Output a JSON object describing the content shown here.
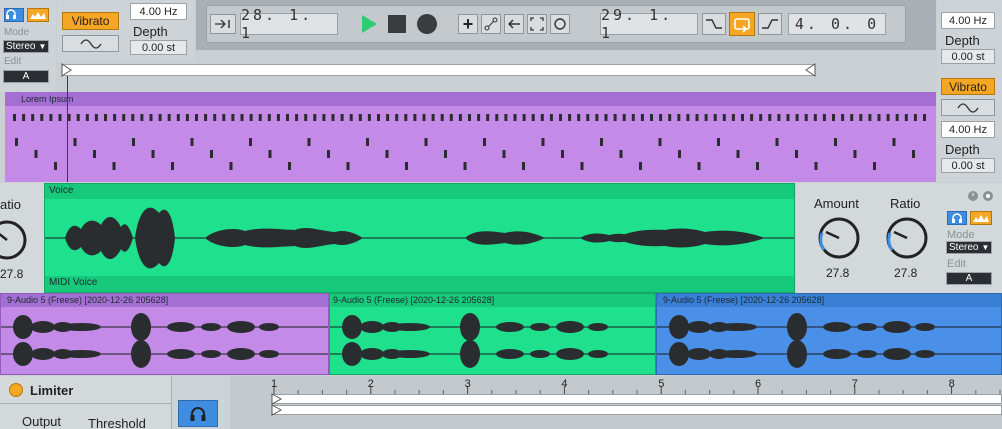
{
  "topleft": {
    "mode_label": "Mode",
    "mode_value": "Stereo",
    "edit_label": "Edit",
    "edit_value": "A"
  },
  "vibrato_left": {
    "button_label": "Vibrato",
    "rate_value": "4.00 Hz",
    "depth_label": "Depth",
    "depth_value": "0.00 st"
  },
  "transport": {
    "position": "28. 1. 1",
    "loop_start": "29. 1. 1",
    "loop_length": "4. 0. 0"
  },
  "right_top": {
    "rate_value": "4.00 Hz",
    "depth_label": "Depth",
    "depth_value": "0.00 st",
    "vibrato_label": "Vibrato",
    "rate_value2": "4.00 Hz",
    "depth_label2": "Depth",
    "depth_value2": "0.00 st"
  },
  "clips": {
    "midi_clip_title": "Lorem Ipsum",
    "voice_clip_title": "Voice",
    "midi_voice_label": "MIDI Voice",
    "audio_clip_1": "9-Audio 5 (Freese) [2020-12-26 205628]",
    "audio_clip_2": "9-Audio 5 (Freese) [2020-12-26 205628]",
    "audio_clip_3": "9-Audio 5 (Freese) [2020-12-26 205628]"
  },
  "left_knob": {
    "label": "atio",
    "value": "27.8"
  },
  "right_device": {
    "amount_label": "Amount",
    "amount_value": "27.8",
    "ratio_label": "Ratio",
    "ratio_value": "27.8",
    "mode_label": "Mode",
    "mode_value": "Stereo",
    "edit_label": "Edit",
    "edit_value": "A"
  },
  "limiter": {
    "title": "Limiter",
    "output_label": "Output",
    "threshold_label": "Threshold"
  },
  "ruler": {
    "bars": [
      "1",
      "2",
      "3",
      "4",
      "5",
      "6",
      "7",
      "8"
    ]
  },
  "colors": {
    "midi_purple": "#b783e6",
    "voice_green": "#1fe08c",
    "audio_blue": "#4a90e8",
    "accent_orange": "#f5a623"
  }
}
